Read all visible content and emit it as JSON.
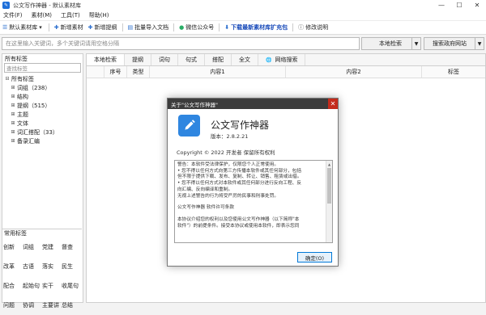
{
  "window": {
    "title": "公文写作神器 - 默认素材库",
    "app_icon": "pen-icon",
    "min": "—",
    "max": "☐",
    "close": "✕"
  },
  "menu": [
    "文件(F)",
    "素材(M)",
    "工具(T)",
    "帮助(H)"
  ],
  "toolbar": {
    "default_lib": "默认素材库",
    "new_material": "新增素材",
    "new_outline": "新增提纲",
    "batch_import": "批量导入文档",
    "wechat": "微信公众号",
    "download": "下载最新素材库扩充包",
    "change_log": "修改说明"
  },
  "search": {
    "placeholder": "在这里输入关键词，多个关键词请用空格分隔",
    "local_search": "本地检索",
    "gov_search": "搜索政府网站"
  },
  "left": {
    "all_tags_title": "所有标签",
    "filter_placeholder": "查找标签",
    "tree": [
      {
        "label": "所有标签",
        "expand": "⊟",
        "indent": 0
      },
      {
        "label": "词组（238）",
        "expand": "⊞",
        "indent": 1
      },
      {
        "label": "结构",
        "expand": "⊞",
        "indent": 1
      },
      {
        "label": "提纲（515）",
        "expand": "⊞",
        "indent": 1
      },
      {
        "label": "主题",
        "expand": "⊞",
        "indent": 1
      },
      {
        "label": "文体",
        "expand": "⊞",
        "indent": 1
      },
      {
        "label": "词汇搭配（33）",
        "expand": "⊞",
        "indent": 1
      },
      {
        "label": "备录汇编",
        "expand": "⊞",
        "indent": 1
      }
    ],
    "common_tags_title": "常用标签",
    "common_tags": [
      "创新",
      "词组",
      "党建",
      "督查",
      "改革",
      "古语",
      "落实",
      "民生",
      "配合",
      "起始句",
      "实干",
      "收尾句",
      "问题",
      "协调",
      "主要讲",
      "总结"
    ]
  },
  "main": {
    "tabs": [
      "本地检索",
      "提纲",
      "词句",
      "句式",
      "搭配",
      "全文",
      "网络搜索"
    ],
    "columns": [
      "序号",
      "类型",
      "内容1",
      "内容2",
      "标签"
    ]
  },
  "dialog": {
    "title": "关于\"公文写作神器\"",
    "close": "✕",
    "app_name": "公文写作神器",
    "version": "版本：2.8.2.21",
    "copyright": "Copyright © 2022 开发者 保留所有权利",
    "text_lines": [
      "警告：本软件受法律保护，仅限您个人正常使用。",
      "• 您不得以任何方式向第三方传播本软件或其任何部分，包括",
      "但不限于提供下载、发布、复制、转让、销售、租赁或出借。",
      "• 您不得以任何方式对本软件或其任何部分进行反向工程、反",
      "向汇编、反向编译和重制。",
      "无视上述警告的行为将受严厉的民事和刑事处罚。",
      "",
      "公文写作神器 软件许可条款",
      "",
      "本协议介绍您的权利以及您使用公文写作神器（以下简称\"本",
      "软件\"）的前提条件。接受本协议或使用本软件，即表示您同"
    ],
    "ok": "确定(O)"
  },
  "colors": {
    "accent": "#2f86e0",
    "dialog_title_bg": "#3c3c3c",
    "close_red": "#c42b1c",
    "download_link": "#1447b8"
  }
}
